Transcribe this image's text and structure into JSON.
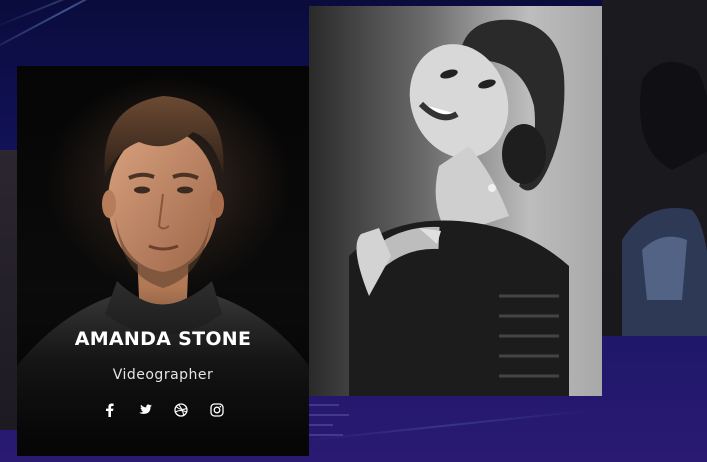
{
  "team": {
    "featured": {
      "name": "AMANDA STONE",
      "role": "Videographer",
      "socials": [
        {
          "icon": "facebook-icon"
        },
        {
          "icon": "twitter-icon"
        },
        {
          "icon": "dribbble-icon"
        },
        {
          "icon": "instagram-icon"
        }
      ]
    }
  },
  "colors": {
    "background_top": "#0a0c3d",
    "background_bottom": "#2a1a72",
    "text_primary": "#ffffff"
  }
}
